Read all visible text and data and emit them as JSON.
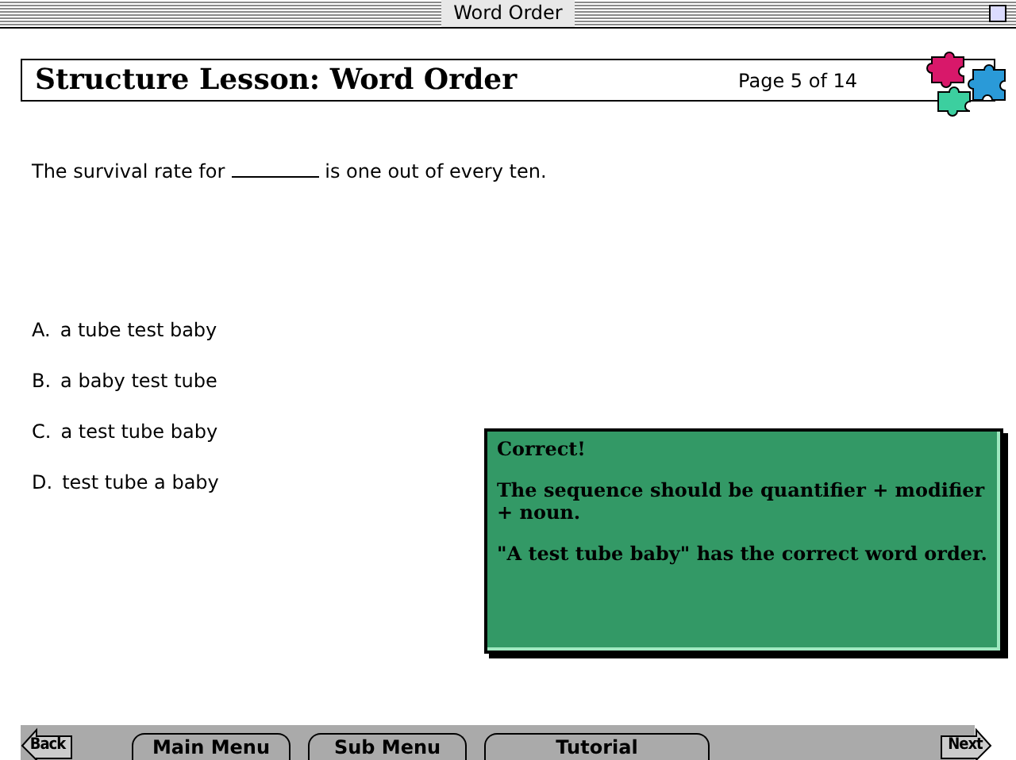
{
  "window": {
    "title": "Word Order"
  },
  "header": {
    "title": "Structure Lesson: Word Order",
    "page": "Page 5 of 14"
  },
  "question": {
    "before": "The survival rate for",
    "after": "is one out of every ten."
  },
  "options": [
    {
      "letter": "A.",
      "text": "a tube test baby"
    },
    {
      "letter": "B.",
      "text": "a baby test tube"
    },
    {
      "letter": "C.",
      "text": "a test tube baby"
    },
    {
      "letter": "D.",
      "text": "test tube a baby"
    }
  ],
  "feedback": {
    "heading": "Correct!",
    "paragraphs": [
      "The sequence should be quantifier + modifier + noun.",
      "\"A test tube baby\" has the correct word order."
    ]
  },
  "nav": {
    "back": "Back",
    "next": "Next",
    "tabs": [
      {
        "label": "Main Menu"
      },
      {
        "label": "Sub Menu"
      },
      {
        "label": "Tutorial"
      }
    ]
  }
}
